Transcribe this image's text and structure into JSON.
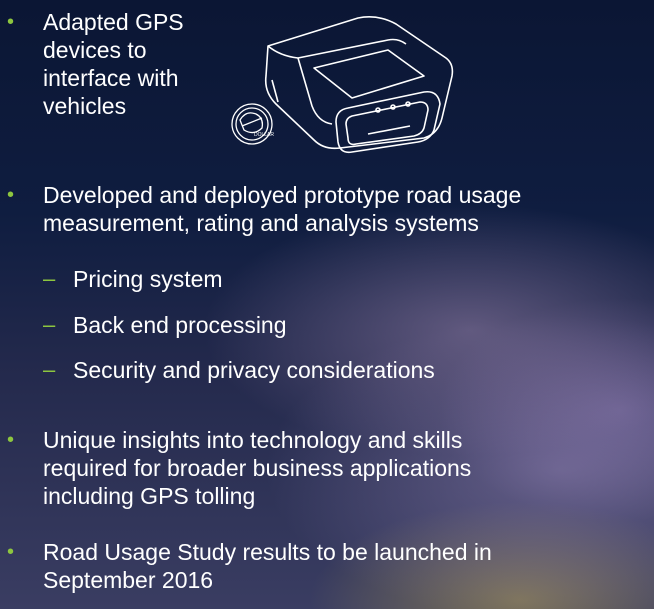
{
  "bullets": {
    "b1": [
      "Adapted GPS",
      "devices to",
      "interface with",
      "vehicles"
    ],
    "b2": [
      "Developed and deployed prototype road usage",
      "measurement, rating and analysis systems"
    ],
    "sub": [
      "Pricing system",
      "Back end processing",
      "Security and privacy considerations"
    ],
    "b3": [
      "Unique insights into technology and skills",
      "required for broader business applications",
      "including GPS tolling"
    ],
    "b4": [
      "Road Usage Study results to be launched in",
      "September 2016"
    ]
  },
  "colors": {
    "bullet": "#8dc63f",
    "text": "#ffffff"
  },
  "image": {
    "name": "obd-gps-device-with-coin",
    "coin_text": "DOLLAR"
  }
}
